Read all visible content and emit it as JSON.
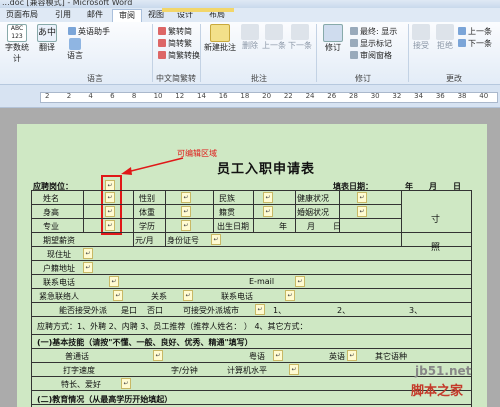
{
  "window": {
    "title": "...doc [兼容模式] - Microsoft Word"
  },
  "ribbon_tabs": [
    "页面布局",
    "引用",
    "邮件",
    "审阅",
    "视图",
    "设计",
    "布局"
  ],
  "ribbon": {
    "proofing": {
      "word_count": "字数统计",
      "translate": "翻译",
      "language": "语言",
      "english_assistant": "英语助手",
      "group_label": "语言"
    },
    "chinese_conversion": {
      "to_simplified": "繁转简",
      "to_traditional": "简转繁",
      "convert": "简繁转换",
      "group_label": "中文简繁转换"
    },
    "comments": {
      "new_comment": "新建批注",
      "delete": "删除",
      "previous": "上一条",
      "next": "下一条",
      "group_label": "批注"
    },
    "tracking": {
      "track_changes": "修订",
      "final_label": "最终: 显示",
      "show_markup": "显示标记",
      "reviewing_pane": "审阅窗格",
      "group_label": "修订"
    },
    "changes": {
      "accept": "接受",
      "reject": "拒绝",
      "previous": "上一条",
      "next": "下一条",
      "group_label": "更改"
    }
  },
  "ruler": {
    "numbers": [
      "2",
      "2",
      "4",
      "6",
      "8",
      "10",
      "12",
      "14",
      "16",
      "18",
      "20",
      "22",
      "24",
      "26",
      "28",
      "30",
      "32",
      "34",
      "36",
      "38",
      "40"
    ]
  },
  "annotation": {
    "text": "可编辑区域"
  },
  "form": {
    "title": "员工入职申请表",
    "position_label": "应聘岗位：",
    "date_label": "填表日期：",
    "year": "年",
    "month": "月",
    "day": "日",
    "name": "姓名",
    "gender": "性别",
    "ethnicity": "民族",
    "health": "健康状况",
    "height": "身高",
    "weight": "体重",
    "blood_type": "籍贯",
    "marital": "婚姻状况",
    "major": "专业",
    "education": "学历",
    "birth_date": "出生日期",
    "photo_1": "寸",
    "photo_2": "照",
    "expected_salary": "期望薪资",
    "salary_unit": "元/月",
    "id_number": "身份证号",
    "current_address": "现住址",
    "hukou_address": "户籍地址",
    "phone": "联系电话",
    "email": "E-mail",
    "emergency_contact": "紧急联络人",
    "relation": "关系",
    "contact_phone": "联系电话",
    "accept_relocation": "能否接受外派",
    "yes": "是口",
    "no": "否口",
    "acceptable_city": "可接受外派城市",
    "city_1": "1、",
    "city_2": "2、",
    "city_3": "3、",
    "application_method": "应聘方式：1、外聘   2、内聘   3、员工推荐（推荐人姓名：     ）  4、其它方式：",
    "section_skills": "(一)基本技能（请按\"不懂、一般、良好、优秀、精通\"填写）",
    "mandarin": "普通话",
    "cantonese": "粤语",
    "english": "英语",
    "other_lang": "其它语种",
    "typing_speed": "打字速度",
    "typing_unit": "字/分钟",
    "computer_level": "计算机水平",
    "specialties": "特长、爱好",
    "section_education": "(二)教育情况（从最高学历开始填起）"
  },
  "watermark": {
    "text": "jb51.net",
    "sub": "脚本之家"
  },
  "colors": {
    "page_bg": "#cfe8c4",
    "annotation": "#e01818",
    "field_bg": "#fffbd2"
  }
}
